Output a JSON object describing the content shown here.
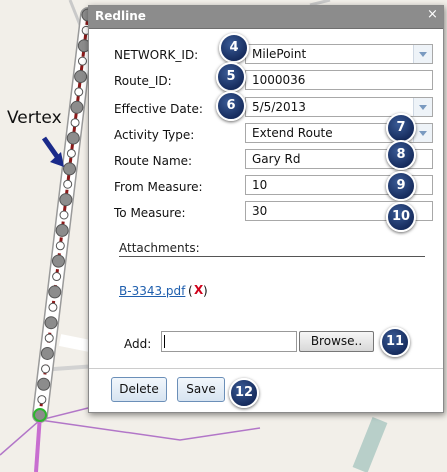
{
  "map": {
    "vertex_label": "Vertex"
  },
  "dialog": {
    "title": "Redline",
    "close_symbol": "×",
    "fields": [
      {
        "label": "NETWORK_ID:",
        "value": "MilePoint",
        "kind": "select",
        "badge": "4"
      },
      {
        "label": "Route_ID:",
        "value": "1000036",
        "kind": "text",
        "badge": "5"
      },
      {
        "label": "Effective Date:",
        "value": "5/5/2013",
        "kind": "select",
        "badge": "6"
      },
      {
        "label": "Activity Type:",
        "value": "Extend Route",
        "kind": "select",
        "badge": "7"
      },
      {
        "label": "Route Name:",
        "value": "Gary Rd",
        "kind": "text",
        "badge": "8"
      },
      {
        "label": "From Measure:",
        "value": "10",
        "kind": "text",
        "badge": "9"
      },
      {
        "label": "To Measure:",
        "value": "30",
        "kind": "text",
        "badge": "10"
      }
    ],
    "attachments": {
      "heading": "Attachments:",
      "file_link": "B-3343.pdf",
      "open_paren": "(",
      "remove_symbol": "X",
      "close_paren": ")"
    },
    "add": {
      "label": "Add:",
      "value": "",
      "browse_label": "Browse..",
      "badge": "11"
    },
    "buttons": {
      "delete_label": "Delete",
      "save_label": "Save",
      "badge": "12"
    }
  },
  "colors": {
    "title_bar": "#8c8c8c",
    "badge": "#1a3166",
    "route_line": "#8b1a1a",
    "link": "#1f5fae",
    "remove": "#d0021b"
  }
}
